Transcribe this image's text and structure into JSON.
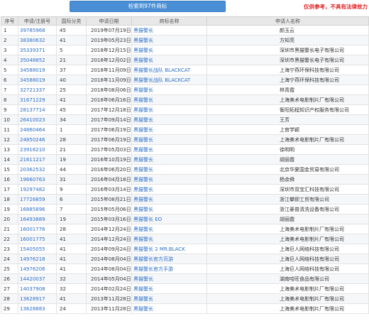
{
  "header": {
    "result_label": "检索到97件商标",
    "disclaimer": "仅供参考，不具有法律效力"
  },
  "columns": [
    "序号",
    "申请/注册号",
    "国际分类",
    "申请日期",
    "商标名称",
    "申请人名称"
  ],
  "rows": [
    {
      "idx": "1",
      "reg": "39785968",
      "cls": "45",
      "date": "2019年07月19日",
      "name": "黑猫警长",
      "applicant": "颜玉云"
    },
    {
      "idx": "2",
      "reg": "38380632",
      "cls": "41",
      "date": "2019年05月23日",
      "name": "黑猫警长",
      "applicant": "方知亮"
    },
    {
      "idx": "3",
      "reg": "35339371",
      "cls": "5",
      "date": "2018年12月15日",
      "name": "黑猫警长",
      "applicant": "深圳市黑猫警长电子有限公司"
    },
    {
      "idx": "4",
      "reg": "35048852",
      "cls": "21",
      "date": "2018年12月02日",
      "name": "黑猫警长",
      "applicant": "深圳市黑猫警长电子有限公司"
    },
    {
      "idx": "5",
      "reg": "34588019",
      "cls": "37",
      "date": "2018年11月09日",
      "name": "黑猫警长战队 BLACKCAT",
      "applicant": "上海宁燕环保科技有限公司"
    },
    {
      "idx": "6",
      "reg": "34588019",
      "cls": "40",
      "date": "2018年11月09日",
      "name": "黑猫警长战队 BLACKCAT",
      "applicant": "上海宁燕环保科技有限公司"
    },
    {
      "idx": "7",
      "reg": "32721337",
      "cls": "25",
      "date": "2018年08月06日",
      "name": "黑猫警长",
      "applicant": "林青霞"
    },
    {
      "idx": "8",
      "reg": "31671229",
      "cls": "41",
      "date": "2018年06月16日",
      "name": "黑猫警长",
      "applicant": "上海美术电影制片厂有限公司"
    },
    {
      "idx": "9",
      "reg": "28137714",
      "cls": "45",
      "date": "2017年12月18日",
      "name": "黑猫警长",
      "applicant": "衡阳拓程知识产权服务有限公司"
    },
    {
      "idx": "10",
      "reg": "26410023",
      "cls": "34",
      "date": "2017年09月14日",
      "name": "黑猫警长",
      "applicant": "王芳"
    },
    {
      "idx": "11",
      "reg": "24860464",
      "cls": "1",
      "date": "2017年06月19日",
      "name": "黑猫警长",
      "applicant": "上官学颖"
    },
    {
      "idx": "12",
      "reg": "24850246",
      "cls": "28",
      "date": "2017年06月19日",
      "name": "黑猫警长",
      "applicant": "上海美术电影制片厂有限公司"
    },
    {
      "idx": "13",
      "reg": "23916210",
      "cls": "21",
      "date": "2017年05月03日",
      "name": "黑猫警长",
      "applicant": "徐明明"
    },
    {
      "idx": "14",
      "reg": "21611217",
      "cls": "19",
      "date": "2016年10月19日",
      "name": "黑猫警长",
      "applicant": "胡丽霞"
    },
    {
      "idx": "15",
      "reg": "20362532",
      "cls": "44",
      "date": "2016年06月20日",
      "name": "黑猫警长",
      "applicant": "北京华夏国金贸易有限公司"
    },
    {
      "idx": "16",
      "reg": "19660763",
      "cls": "31",
      "date": "2016年04月18日",
      "name": "黑猫警长",
      "applicant": "杨余舜"
    },
    {
      "idx": "17",
      "reg": "19297482",
      "cls": "9",
      "date": "2016年03月14日",
      "name": "黑猫警长",
      "applicant": "深圳市双宝汇科技有限公司"
    },
    {
      "idx": "18",
      "reg": "17726859",
      "cls": "6",
      "date": "2015年08月21日",
      "name": "黑猫警长",
      "applicant": "浙江攀即工贸有限公司"
    },
    {
      "idx": "19",
      "reg": "16885896",
      "cls": "7",
      "date": "2015年05月06日",
      "name": "黑猫警长",
      "applicant": "浙江豪普清洗设备有限公司"
    },
    {
      "idx": "20",
      "reg": "16493889",
      "cls": "19",
      "date": "2015年03月16日",
      "name": "黑猫警长 EO",
      "applicant": "胡丽霞"
    },
    {
      "idx": "21",
      "reg": "16001776",
      "cls": "28",
      "date": "2014年12月24日",
      "name": "黑猫警长",
      "applicant": "上海美术电影制片厂有限公司"
    },
    {
      "idx": "22",
      "reg": "16001775",
      "cls": "41",
      "date": "2014年12月24日",
      "name": "黑猫警长",
      "applicant": "上海美术电影制片厂有限公司"
    },
    {
      "idx": "23",
      "reg": "15405055",
      "cls": "41",
      "date": "2014年09月24日",
      "name": "黑猫警长 2 MR.BLACK",
      "applicant": "上海巨人网络科技有限公司"
    },
    {
      "idx": "24",
      "reg": "14976218",
      "cls": "41",
      "date": "2014年08月04日",
      "name": "黑猫警长官方页游",
      "applicant": "上海巨人网络科技有限公司"
    },
    {
      "idx": "25",
      "reg": "14976206",
      "cls": "41",
      "date": "2014年08月04日",
      "name": "黑猫警长官方手游",
      "applicant": "上海巨人网络科技有限公司"
    },
    {
      "idx": "26",
      "reg": "14420037",
      "cls": "32",
      "date": "2014年05月04日",
      "name": "黑猫警长",
      "applicant": "湖南哈旺食品有限公司"
    },
    {
      "idx": "27",
      "reg": "14037908",
      "cls": "32",
      "date": "2014年02月24日",
      "name": "黑猫警长",
      "applicant": "上海美术电影制片厂有限公司"
    },
    {
      "idx": "28",
      "reg": "13628917",
      "cls": "41",
      "date": "2013年11月28日",
      "name": "黑猫警长",
      "applicant": "上海美术电影制片厂有限公司"
    },
    {
      "idx": "29",
      "reg": "13628883",
      "cls": "24",
      "date": "2013年11月28日",
      "name": "黑猫警长",
      "applicant": "上海美术电影制片厂有限公司"
    }
  ]
}
